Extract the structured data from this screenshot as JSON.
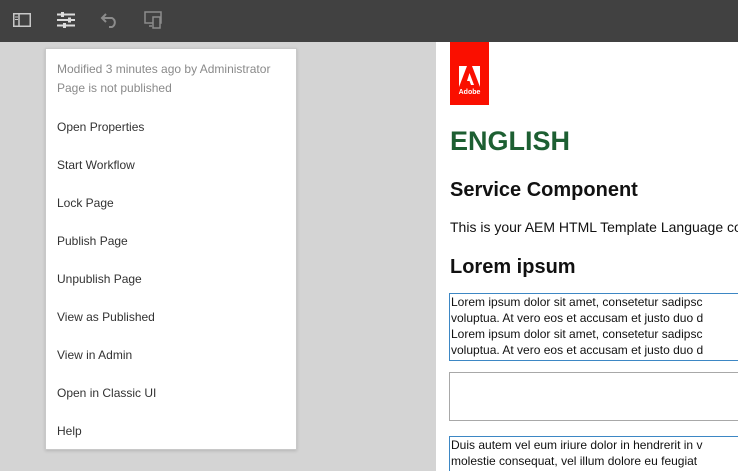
{
  "toolbar": {
    "buttons": [
      {
        "name": "side-panel-icon"
      },
      {
        "name": "page-information-icon"
      },
      {
        "name": "undo-icon"
      },
      {
        "name": "emulator-icon"
      }
    ]
  },
  "page_info_menu": {
    "modified": "Modified 3 minutes ago by Administrator",
    "status": "Page is not published",
    "items": [
      "Open Properties",
      "Start Workflow",
      "Lock Page",
      "Publish Page",
      "Unpublish Page",
      "View as Published",
      "View in Admin",
      "Open in Classic UI",
      "Help"
    ]
  },
  "page_content": {
    "logo_text": "Adobe",
    "logo_color": "#fa0f00",
    "title": "ENGLISH",
    "title_color": "#1d5f32",
    "service_heading": "Service Component",
    "service_text": "This is your AEM HTML Template Language co",
    "lorem_heading": "Lorem ipsum",
    "lorem_lines": [
      "Lorem ipsum dolor sit amet, consetetur sadipsc",
      "voluptua. At vero eos et accusam et justo duo d",
      "Lorem ipsum dolor sit amet, consetetur sadipsc",
      "voluptua. At vero eos et accusam et justo duo d"
    ],
    "duis_lines": [
      "Duis autem vel eum iriure dolor in hendrerit in v",
      "molestie consequat, vel illum dolore eu feugiat"
    ]
  }
}
